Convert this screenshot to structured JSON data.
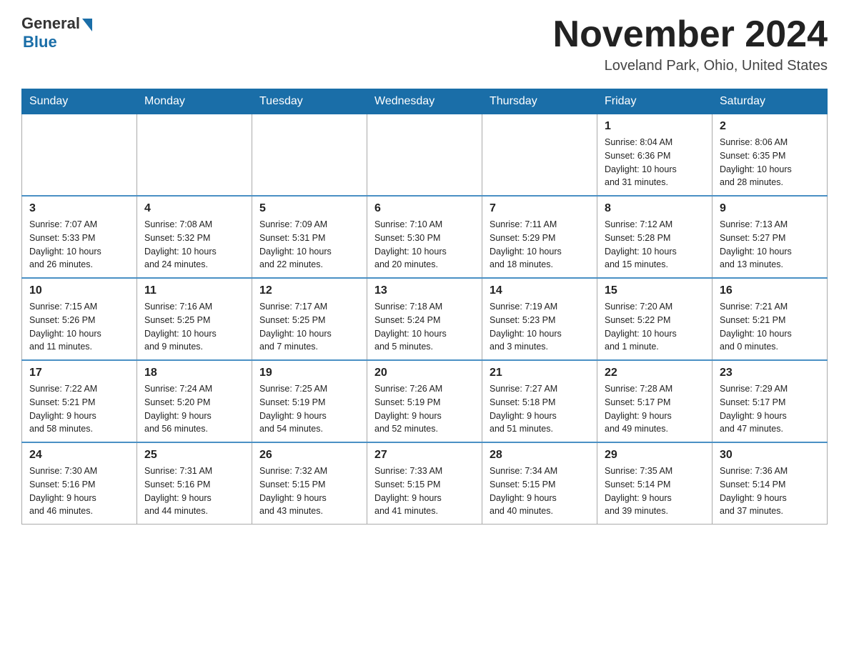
{
  "header": {
    "logo_general": "General",
    "logo_blue": "Blue",
    "month_title": "November 2024",
    "location": "Loveland Park, Ohio, United States"
  },
  "weekdays": [
    "Sunday",
    "Monday",
    "Tuesday",
    "Wednesday",
    "Thursday",
    "Friday",
    "Saturday"
  ],
  "weeks": [
    [
      {
        "day": "",
        "info": ""
      },
      {
        "day": "",
        "info": ""
      },
      {
        "day": "",
        "info": ""
      },
      {
        "day": "",
        "info": ""
      },
      {
        "day": "",
        "info": ""
      },
      {
        "day": "1",
        "info": "Sunrise: 8:04 AM\nSunset: 6:36 PM\nDaylight: 10 hours\nand 31 minutes."
      },
      {
        "day": "2",
        "info": "Sunrise: 8:06 AM\nSunset: 6:35 PM\nDaylight: 10 hours\nand 28 minutes."
      }
    ],
    [
      {
        "day": "3",
        "info": "Sunrise: 7:07 AM\nSunset: 5:33 PM\nDaylight: 10 hours\nand 26 minutes."
      },
      {
        "day": "4",
        "info": "Sunrise: 7:08 AM\nSunset: 5:32 PM\nDaylight: 10 hours\nand 24 minutes."
      },
      {
        "day": "5",
        "info": "Sunrise: 7:09 AM\nSunset: 5:31 PM\nDaylight: 10 hours\nand 22 minutes."
      },
      {
        "day": "6",
        "info": "Sunrise: 7:10 AM\nSunset: 5:30 PM\nDaylight: 10 hours\nand 20 minutes."
      },
      {
        "day": "7",
        "info": "Sunrise: 7:11 AM\nSunset: 5:29 PM\nDaylight: 10 hours\nand 18 minutes."
      },
      {
        "day": "8",
        "info": "Sunrise: 7:12 AM\nSunset: 5:28 PM\nDaylight: 10 hours\nand 15 minutes."
      },
      {
        "day": "9",
        "info": "Sunrise: 7:13 AM\nSunset: 5:27 PM\nDaylight: 10 hours\nand 13 minutes."
      }
    ],
    [
      {
        "day": "10",
        "info": "Sunrise: 7:15 AM\nSunset: 5:26 PM\nDaylight: 10 hours\nand 11 minutes."
      },
      {
        "day": "11",
        "info": "Sunrise: 7:16 AM\nSunset: 5:25 PM\nDaylight: 10 hours\nand 9 minutes."
      },
      {
        "day": "12",
        "info": "Sunrise: 7:17 AM\nSunset: 5:25 PM\nDaylight: 10 hours\nand 7 minutes."
      },
      {
        "day": "13",
        "info": "Sunrise: 7:18 AM\nSunset: 5:24 PM\nDaylight: 10 hours\nand 5 minutes."
      },
      {
        "day": "14",
        "info": "Sunrise: 7:19 AM\nSunset: 5:23 PM\nDaylight: 10 hours\nand 3 minutes."
      },
      {
        "day": "15",
        "info": "Sunrise: 7:20 AM\nSunset: 5:22 PM\nDaylight: 10 hours\nand 1 minute."
      },
      {
        "day": "16",
        "info": "Sunrise: 7:21 AM\nSunset: 5:21 PM\nDaylight: 10 hours\nand 0 minutes."
      }
    ],
    [
      {
        "day": "17",
        "info": "Sunrise: 7:22 AM\nSunset: 5:21 PM\nDaylight: 9 hours\nand 58 minutes."
      },
      {
        "day": "18",
        "info": "Sunrise: 7:24 AM\nSunset: 5:20 PM\nDaylight: 9 hours\nand 56 minutes."
      },
      {
        "day": "19",
        "info": "Sunrise: 7:25 AM\nSunset: 5:19 PM\nDaylight: 9 hours\nand 54 minutes."
      },
      {
        "day": "20",
        "info": "Sunrise: 7:26 AM\nSunset: 5:19 PM\nDaylight: 9 hours\nand 52 minutes."
      },
      {
        "day": "21",
        "info": "Sunrise: 7:27 AM\nSunset: 5:18 PM\nDaylight: 9 hours\nand 51 minutes."
      },
      {
        "day": "22",
        "info": "Sunrise: 7:28 AM\nSunset: 5:17 PM\nDaylight: 9 hours\nand 49 minutes."
      },
      {
        "day": "23",
        "info": "Sunrise: 7:29 AM\nSunset: 5:17 PM\nDaylight: 9 hours\nand 47 minutes."
      }
    ],
    [
      {
        "day": "24",
        "info": "Sunrise: 7:30 AM\nSunset: 5:16 PM\nDaylight: 9 hours\nand 46 minutes."
      },
      {
        "day": "25",
        "info": "Sunrise: 7:31 AM\nSunset: 5:16 PM\nDaylight: 9 hours\nand 44 minutes."
      },
      {
        "day": "26",
        "info": "Sunrise: 7:32 AM\nSunset: 5:15 PM\nDaylight: 9 hours\nand 43 minutes."
      },
      {
        "day": "27",
        "info": "Sunrise: 7:33 AM\nSunset: 5:15 PM\nDaylight: 9 hours\nand 41 minutes."
      },
      {
        "day": "28",
        "info": "Sunrise: 7:34 AM\nSunset: 5:15 PM\nDaylight: 9 hours\nand 40 minutes."
      },
      {
        "day": "29",
        "info": "Sunrise: 7:35 AM\nSunset: 5:14 PM\nDaylight: 9 hours\nand 39 minutes."
      },
      {
        "day": "30",
        "info": "Sunrise: 7:36 AM\nSunset: 5:14 PM\nDaylight: 9 hours\nand 37 minutes."
      }
    ]
  ]
}
